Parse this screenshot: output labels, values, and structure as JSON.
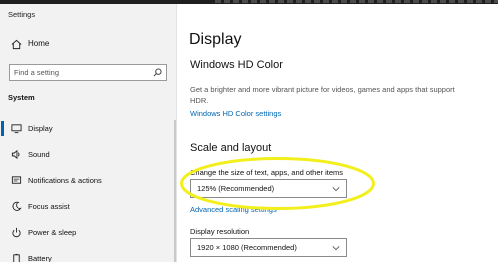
{
  "window": {
    "title": "Settings"
  },
  "sidebar": {
    "home_label": "Home",
    "search_placeholder": "Find a setting",
    "section": "System",
    "items": [
      {
        "label": "Display",
        "icon": "monitor-icon",
        "active": true
      },
      {
        "label": "Sound",
        "icon": "speaker-icon"
      },
      {
        "label": "Notifications & actions",
        "icon": "notification-icon"
      },
      {
        "label": "Focus assist",
        "icon": "moon-icon"
      },
      {
        "label": "Power & sleep",
        "icon": "power-icon"
      },
      {
        "label": "Battery",
        "icon": "battery-icon"
      }
    ]
  },
  "main": {
    "title": "Display",
    "hdr": {
      "heading": "Windows HD Color",
      "description": "Get a brighter and more vibrant picture for videos, games and apps that support HDR.",
      "link": "Windows HD Color settings"
    },
    "scale": {
      "heading": "Scale and layout",
      "size_label": "Change the size of text, apps, and other items",
      "size_value": "125% (Recommended)",
      "advanced_link": "Advanced scaling settings",
      "resolution_label": "Display resolution",
      "resolution_value": "1920 × 1080 (Recommended)"
    }
  },
  "colors": {
    "accent": "#0063b1",
    "link": "#0066b4",
    "highlight": "#f2ef1c",
    "sidebar_bg": "#f2f2f2"
  }
}
